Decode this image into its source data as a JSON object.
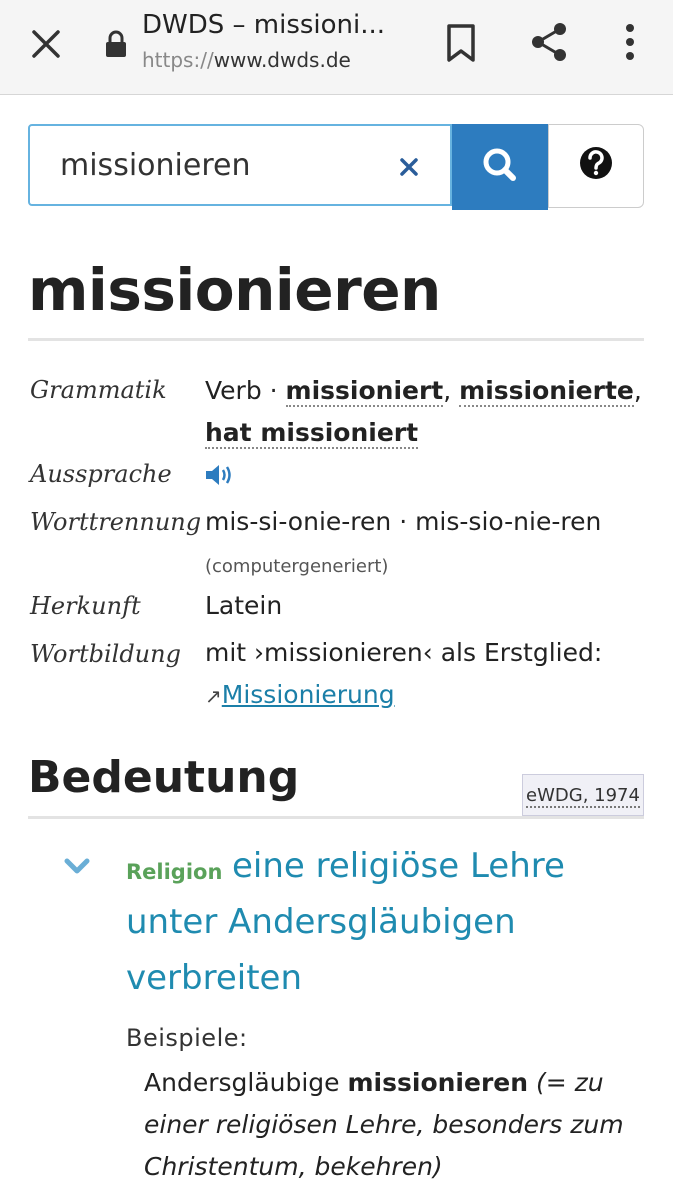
{
  "browser": {
    "title": "DWDS – missioni...",
    "url_scheme": "https://",
    "url_host": "www.dwds.de"
  },
  "search": {
    "value": "missionieren"
  },
  "headword": "missionieren",
  "info": {
    "grammatik_label": "Grammatik",
    "grammatik_pos": "Verb · ",
    "form1": "missioniert",
    "sep1": ", ",
    "form2": "missionierte",
    "sep2": ",",
    "form3": "hat missioniert",
    "aussprache_label": "Aussprache",
    "worttrennung_label": "Worttrennung",
    "worttrennung_value": "mis-si-onie-ren · mis-sio-nie-ren",
    "worttrennung_note": "(computergeneriert)",
    "herkunft_label": "Herkunft",
    "herkunft_value": "Latein",
    "wortbildung_label": "Wortbildung",
    "wortbildung_value": "mit ›missionieren‹ als Erstglied:",
    "wortbildung_arrow": "↗",
    "wortbildung_link": "Missionierung"
  },
  "bedeutung": {
    "title": "Bedeutung",
    "source": "eWDG, 1974",
    "domain": "Religion",
    "def_line1": "eine religiöse Lehre",
    "def_line2": "unter Andersgläubigen",
    "def_line3": "verbreiten",
    "beispiele_label": "Beispiele:",
    "ex_pre": "Andersgläubige ",
    "ex_bold": "missionieren",
    "ex_italic1": " (= zu",
    "ex_line2": "einer religiösen Lehre, besonders zum",
    "ex_line3": "Christentum, bekehren)"
  },
  "colors": {
    "search_button": "#2d7cbf",
    "definition": "#1f8bb0",
    "domain_tag": "#5aa25a"
  }
}
